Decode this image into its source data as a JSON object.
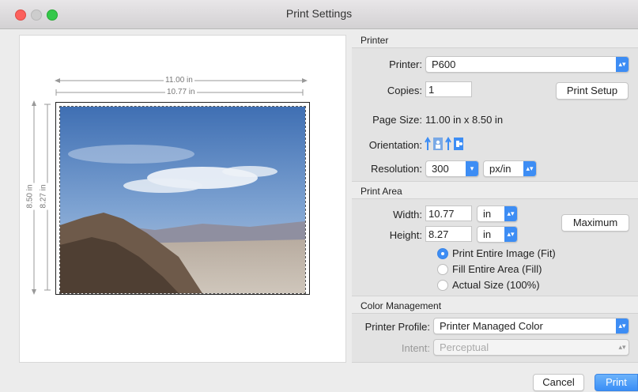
{
  "window": {
    "title": "Print Settings"
  },
  "preview": {
    "width_outer": "11.00 in",
    "width_inner": "10.77 in",
    "height_outer": "8.50 in",
    "height_inner": "8.27 in"
  },
  "printer_section": {
    "heading": "Printer",
    "printer_label": "Printer:",
    "printer_value": "P600",
    "copies_label": "Copies:",
    "copies_value": "1",
    "print_setup_label": "Print Setup",
    "page_size_label": "Page Size:",
    "page_size_value": "11.00 in x 8.50 in",
    "orientation_label": "Orientation:",
    "orientation_icons": [
      "portrait-icon",
      "landscape-icon"
    ],
    "resolution_label": "Resolution:",
    "resolution_value": "300",
    "resolution_unit": "px/in"
  },
  "print_area": {
    "heading": "Print Area",
    "width_label": "Width:",
    "width_value": "10.77",
    "width_unit": "in",
    "height_label": "Height:",
    "height_value": "8.27",
    "height_unit": "in",
    "maximum_label": "Maximum",
    "options": [
      {
        "label": "Print Entire Image (Fit)",
        "selected": true
      },
      {
        "label": "Fill Entire Area (Fill)",
        "selected": false
      },
      {
        "label": "Actual Size (100%)",
        "selected": false
      }
    ]
  },
  "color_management": {
    "heading": "Color Management",
    "profile_label": "Printer Profile:",
    "profile_value": "Printer Managed Color",
    "intent_label": "Intent:",
    "intent_value": "Perceptual"
  },
  "footer": {
    "cancel_label": "Cancel",
    "print_label": "Print"
  },
  "colors": {
    "accent": "#3d8df4",
    "close": "#fc605c",
    "zoom": "#34c84a"
  }
}
